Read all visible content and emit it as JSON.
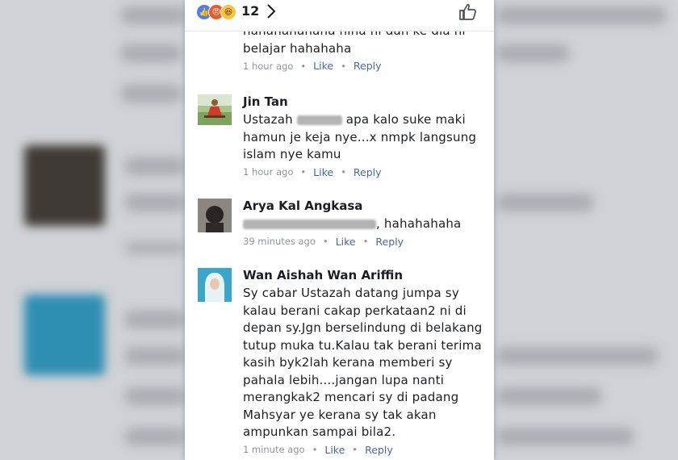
{
  "reactions": {
    "count": "12",
    "icons": [
      "like-icon",
      "angry-icon",
      "haha-icon"
    ]
  },
  "comments": [
    {
      "name": "",
      "lines": [
        "hahahahahaha hina hi dah ke dia ni",
        "belajar  hahahaha"
      ],
      "time": "1 hour ago",
      "like": "Like",
      "reply": "Reply"
    },
    {
      "name": "Jin Tan",
      "line1_pre": "Ustazah",
      "line1_post": "apa kalo suke maki",
      "lines_rest": [
        "hamun je keja nye...x nmpk langsung",
        "islam nye kamu"
      ],
      "time": "1 hour ago",
      "like": "Like",
      "reply": "Reply"
    },
    {
      "name": "Arya Kal Angkasa",
      "line_post": ", hahahahaha",
      "time": "39 minutes ago",
      "like": "Like",
      "reply": "Reply"
    },
    {
      "name": "Wan Aishah Wan Ariffin",
      "lines": [
        "Sy cabar Ustazah datang jumpa sy",
        "kalau berani cakap perkataan2 ni di",
        "depan sy.Jgn berselindung di belakang",
        "tutup muka tu.Kalau tak berani terima",
        "kasih byk2lah kerana memberi sy",
        "pahala lebih....jangan lupa nanti",
        "merangkak2 mencari sy di padang",
        "Mahsyar ye kerana sy tak akan",
        "ampunkan sampai bila2."
      ],
      "time": "1 minute ago",
      "like": "Like",
      "reply": "Reply"
    }
  ],
  "colors": {
    "accent": "#4b67a1",
    "meta": "#90949c",
    "text": "#1c1e21"
  }
}
